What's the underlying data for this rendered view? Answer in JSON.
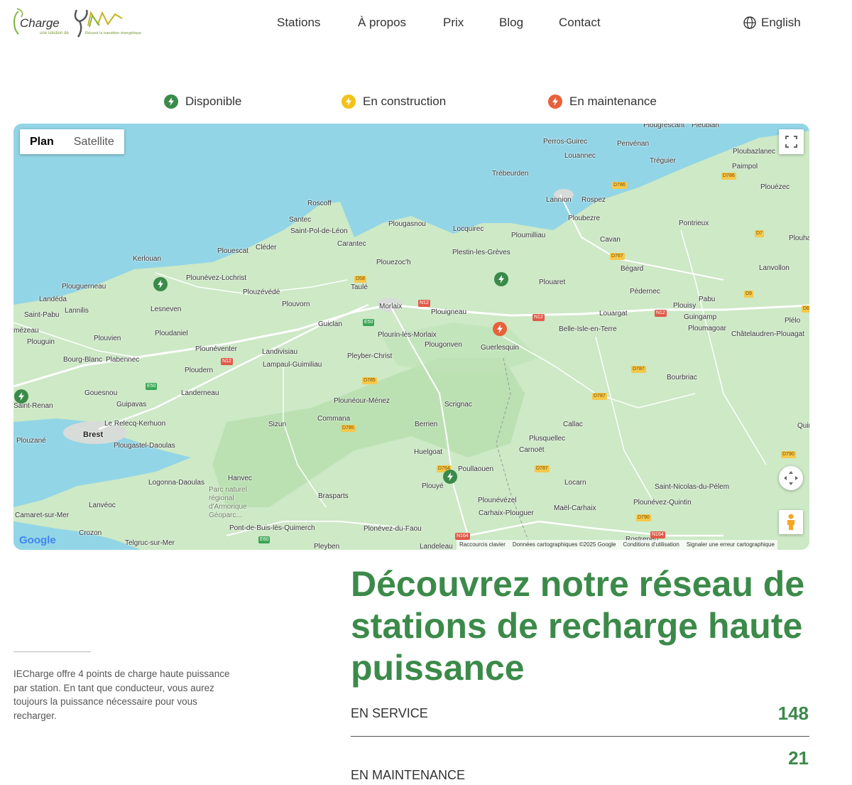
{
  "header": {
    "logo": {
      "name": "Charge",
      "tagline": "une solution de",
      "partner_tagline": "Réussir la transition énergétique"
    },
    "nav": [
      {
        "label": "Stations"
      },
      {
        "label": "À propos"
      },
      {
        "label": "Prix"
      },
      {
        "label": "Blog"
      },
      {
        "label": "Contact"
      }
    ],
    "language": {
      "label": "English",
      "icon": "globe-icon"
    }
  },
  "legend": [
    {
      "label": "Disponible",
      "color": "#3a8a4a"
    },
    {
      "label": "En construction",
      "color": "#f2c21b"
    },
    {
      "label": "En maintenance",
      "color": "#e8603c"
    }
  ],
  "map": {
    "type_control": {
      "plan": "Plan",
      "satellite": "Satellite",
      "selected": "Plan"
    },
    "google_logo": "Google",
    "attribution": [
      "Raccourcis clavier",
      "Données cartographiques ©2025 Google",
      "Conditions d'utilisation",
      "Signaler une erreur cartographique"
    ],
    "places": [
      "Perros-Guirec",
      "Louannec",
      "Penvénan",
      "Tréguier",
      "Ploubazlanec",
      "Paimpol",
      "Trébeurden",
      "Ploubezre",
      "Lannion",
      "Rospez",
      "Plouézec",
      "Roscoff",
      "Santec",
      "Saint-Pol-de-Léon",
      "Carantec",
      "Plougasnou",
      "Locquirec",
      "Ploumilliau",
      "Cavan",
      "Pontrieux",
      "Plestin-les-Grèves",
      "Plouezoc'h",
      "Cléder",
      "Plouescat",
      "Kerlouan",
      "Plounévez-Lochrist",
      "Plouaret",
      "Bégard",
      "Lanvollon",
      "Plouguerneau",
      "Taulé",
      "Plouzévédé",
      "Pédernec",
      "Landéda",
      "Lannilis",
      "Lesneven",
      "Plouvorn",
      "Morlaix",
      "Plouigneau",
      "Louargat",
      "Plouisy",
      "Pabu",
      "Saint-Pabu",
      "Guingamp",
      "Plélo",
      "Ploumagoar",
      "Châtelaudren-Plouagat",
      "Guiclan",
      "Plourin-lès-Morlaix",
      "Belle-Isle-en-Terre",
      "Plouvien",
      "Ploudaniel",
      "Plougonven",
      "Guerlesquin",
      "Plouguin",
      "Plounéventer",
      "Landivisiau",
      "Pleyber-Christ",
      "Bourg-Blanc",
      "Plabennec",
      "Lampaul-Guimiliau",
      "Ploudern",
      "Bourbriac",
      "Gouesnou",
      "Landerneau",
      "Guipavas",
      "Plounéour-Ménez",
      "Scrignac",
      "Le Relecq-Kerhuon",
      "Sizun",
      "Commana",
      "Berrien",
      "Callac",
      "Brest",
      "Plouzané",
      "Plougastel-Daoulas",
      "Plusquellec",
      "Huelgoat",
      "Carnoët",
      "Poullaouen",
      "Logonna-Daoulas",
      "Hanvec",
      "Plouyé",
      "Locarn",
      "Saint-Nicolas-du-Pélem",
      "Parc naturel régional d'Armorique Géoparc...",
      "Brasparts",
      "Plounévézel",
      "Plounévez-Quintin",
      "Lanvéoc",
      "Carhaix-Plouguer",
      "Maël-Carhaix",
      "Camaret-sur-Mer",
      "Crozon",
      "Pont-de-Buis-lès-Quimerch",
      "Plonévez-du-Faou",
      "Telgruc-sur-Mer",
      "Pleyben",
      "Landeleau",
      "Rostrenen",
      "Saint-Renan",
      "mézeau",
      "Quin",
      "Plouha",
      "Plougrescant",
      "Pleubian"
    ],
    "roads": [
      "D786",
      "D786",
      "D7",
      "D767",
      "D58",
      "N12",
      "E50",
      "N12",
      "N12",
      "D9",
      "D6",
      "N12",
      "E50",
      "D787",
      "D785",
      "D787",
      "D785",
      "D764",
      "D787",
      "D790",
      "D790",
      "N164",
      "N164",
      "E60"
    ]
  },
  "description": "IECharge offre 4 points de charge haute puissance par station. En tant que conducteur, vous aurez toujours la puissance nécessaire pour vous recharger.",
  "headline": "Découvrez notre réseau de stations de recharge haute puissance",
  "stats": [
    {
      "label": "EN SERVICE",
      "value": "148"
    },
    {
      "label": "EN MAINTENANCE",
      "value": "21"
    }
  ]
}
